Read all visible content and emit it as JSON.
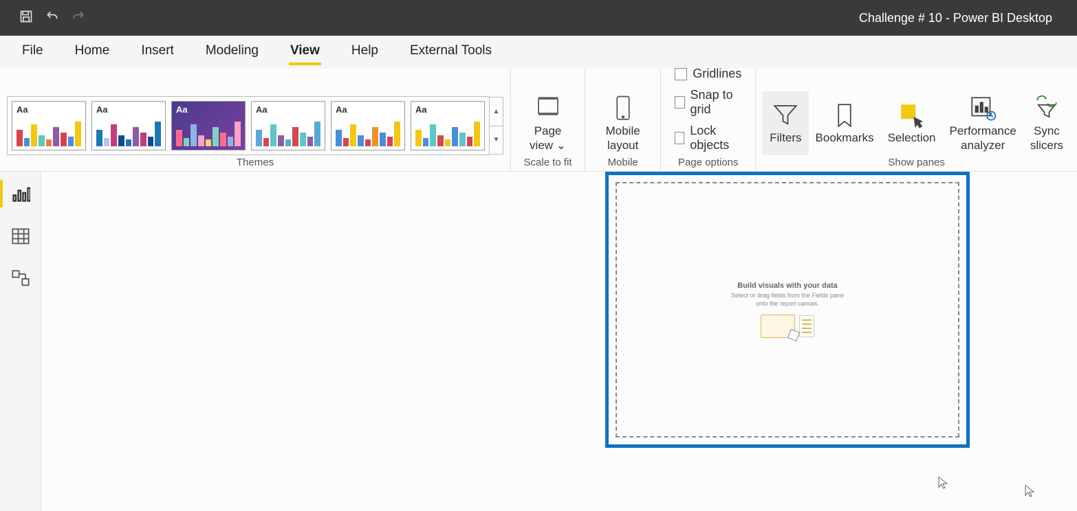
{
  "app_title": "Challenge # 10 - Power BI Desktop",
  "menu": {
    "file": "File",
    "home": "Home",
    "insert": "Insert",
    "modeling": "Modeling",
    "view": "View",
    "help": "Help",
    "external_tools": "External Tools"
  },
  "ribbon": {
    "themes_label": "Themes",
    "theme_aa": "Aa",
    "scale_to_fit": {
      "page_view": "Page view",
      "label": "Scale to fit"
    },
    "mobile": {
      "mobile_layout": "Mobile layout",
      "label": "Mobile"
    },
    "page_options": {
      "gridlines": "Gridlines",
      "snap_to_grid": "Snap to grid",
      "lock_objects": "Lock objects",
      "label": "Page options"
    },
    "show_panes": {
      "filters": "Filters",
      "bookmarks": "Bookmarks",
      "selection": "Selection",
      "performance_analyzer": "Performance analyzer",
      "sync_slicers": "Sync slicers",
      "label": "Show panes"
    }
  },
  "canvas_hint": {
    "title": "Build visuals with your data",
    "subtitle_1": "Select or drag fields from the Fields pane",
    "subtitle_2": "onto the report canvas."
  }
}
